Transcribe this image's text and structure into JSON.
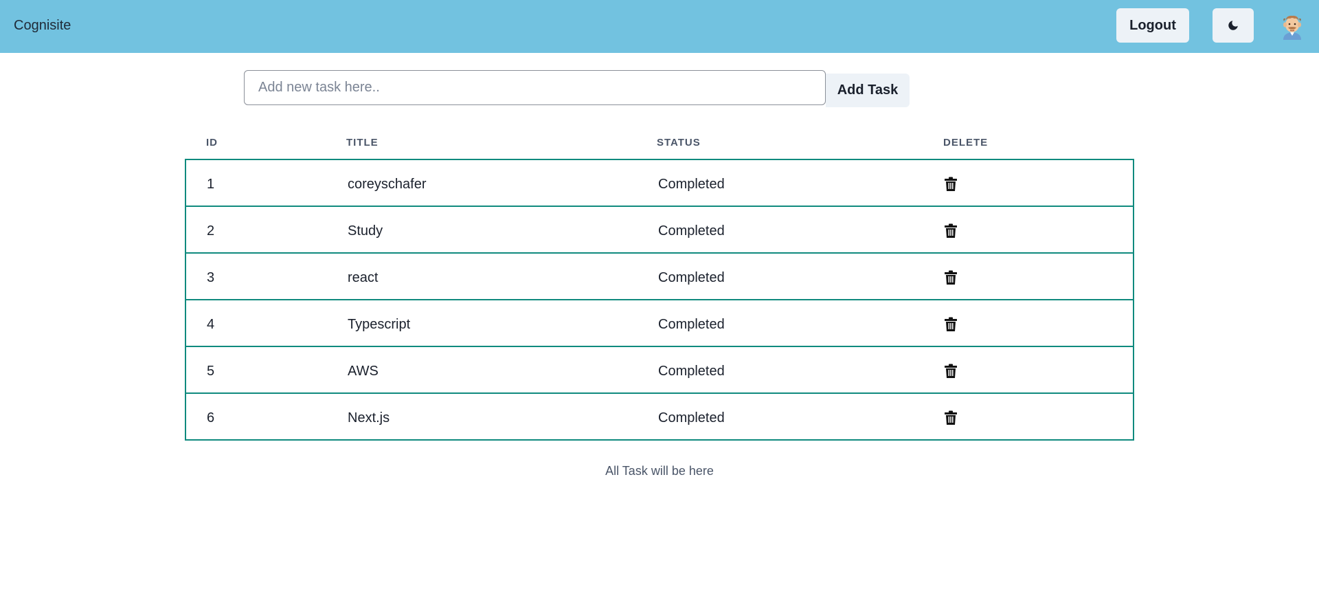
{
  "navbar": {
    "brand": "Cognisite",
    "logout_label": "Logout",
    "theme_icon": "moon-icon",
    "avatar_icon": "avatar"
  },
  "task_form": {
    "placeholder": "Add new task here..",
    "value": "",
    "add_label": "Add Task"
  },
  "table": {
    "headers": [
      "ID",
      "TITLE",
      "STATUS",
      "DELETE"
    ],
    "rows": [
      {
        "id": "1",
        "title": "coreyschafer",
        "status": "Completed"
      },
      {
        "id": "2",
        "title": "Study",
        "status": "Completed"
      },
      {
        "id": "3",
        "title": "react",
        "status": "Completed"
      },
      {
        "id": "4",
        "title": "Typescript",
        "status": "Completed"
      },
      {
        "id": "5",
        "title": "AWS",
        "status": "Completed"
      },
      {
        "id": "6",
        "title": "Next.js",
        "status": "Completed"
      }
    ],
    "delete_icon": "trash-icon"
  },
  "caption": "All Task will be here",
  "colors": {
    "navbar_bg": "#72c2e0",
    "table_border": "#0f8a7e",
    "button_bg": "#edf2f7"
  }
}
